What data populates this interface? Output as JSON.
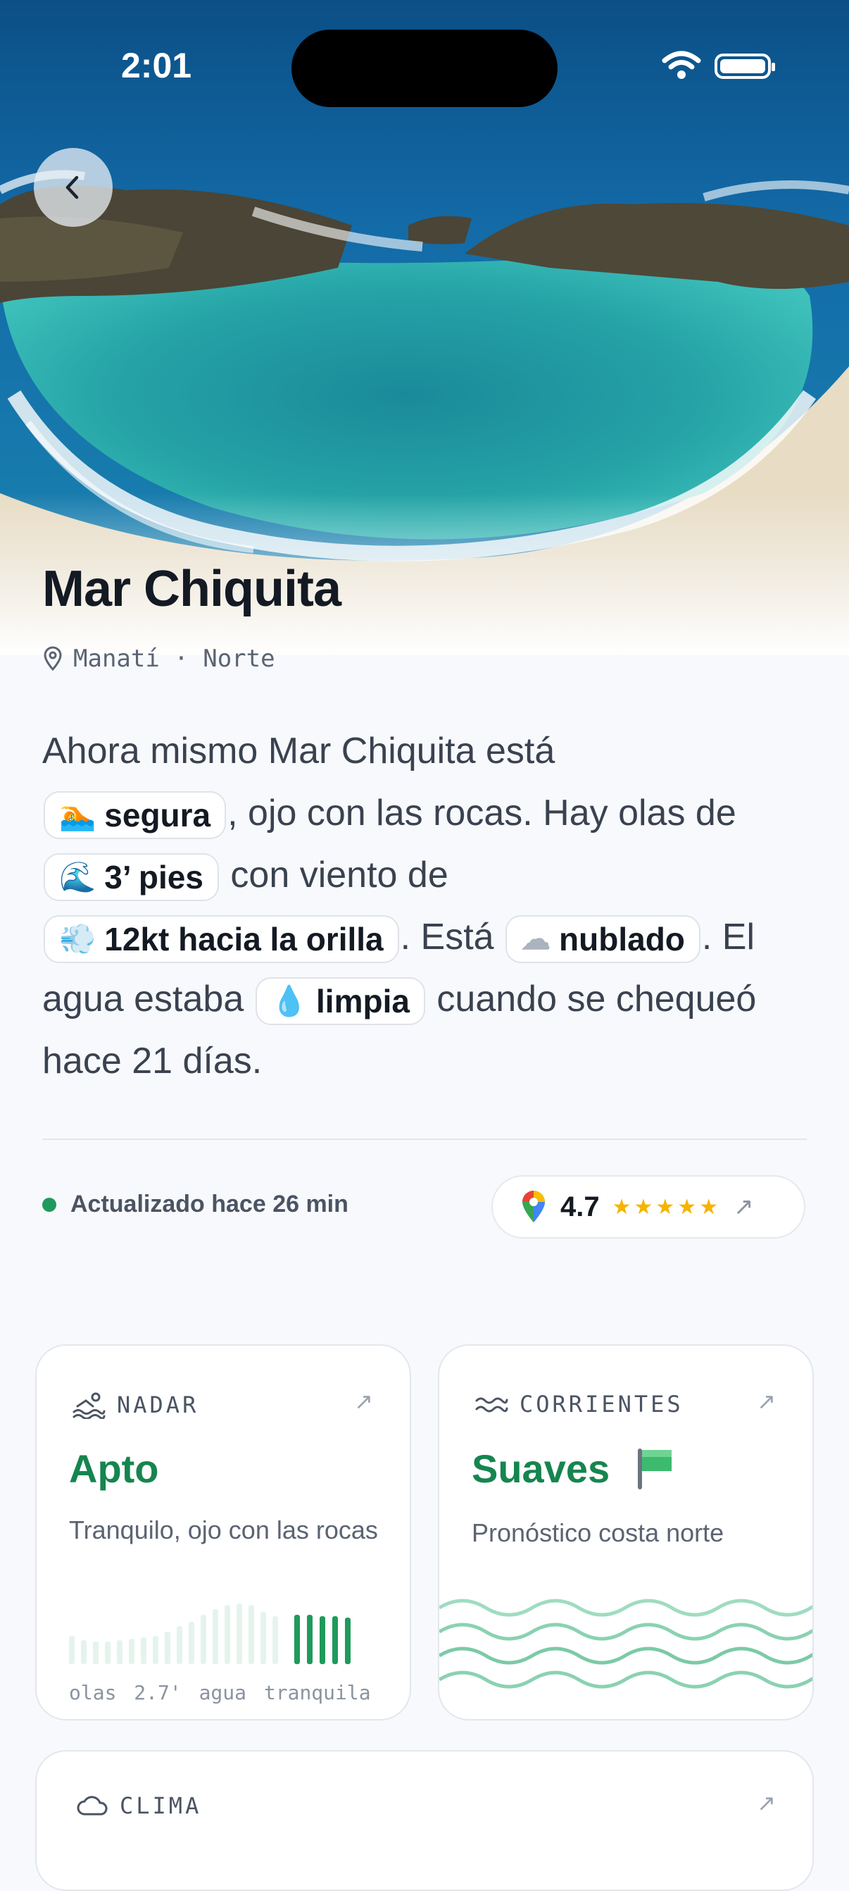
{
  "status_bar": {
    "time": "2:01",
    "icons": [
      "wifi-icon",
      "battery-icon"
    ]
  },
  "hero": {
    "back_icon": "chevron-left-icon"
  },
  "beach": {
    "name": "Mar Chiquita",
    "location": "Manatí · Norte",
    "location_icon": "map-pin-icon"
  },
  "summary": {
    "t1": "Ahora mismo Mar Chiquita está",
    "chip_safe": {
      "icon": "🏊",
      "label": "segura"
    },
    "t2": ", ojo con las rocas. Hay olas de",
    "chip_waves": {
      "icon": "🌊",
      "label": "3’ pies"
    },
    "t3": "con viento de",
    "chip_wind": {
      "icon": "💨",
      "label": "12kt hacia la orilla"
    },
    "t4": ". Está",
    "chip_sky": {
      "icon": "☁",
      "label": "nublado"
    },
    "t5": ". El agua estaba",
    "chip_water": {
      "icon": "💧",
      "label": "limpia"
    },
    "t6": "cuando se chequeó hace 21 días."
  },
  "update": {
    "text": "Actualizado hace 26 min",
    "status_color": "#1f9a5c"
  },
  "rating": {
    "value": "4.7",
    "stars": "★★★★★",
    "stars_value": 4.7,
    "icon": "google-maps-pin-icon",
    "arrow": "↗"
  },
  "cards": {
    "swim": {
      "label": "NADAR",
      "icon": "swimmer-icon",
      "arrow": "↗",
      "status": "Apto",
      "desc": "Tranquilo, ojo con las rocas",
      "footer_waves": "olas 2.7'",
      "footer_water": "agua tranquila"
    },
    "currents": {
      "label": "CORRIENTES",
      "icon": "waves-icon",
      "arrow": "↗",
      "status": "Suaves",
      "flag_icon": "green-flag-icon",
      "desc": "Pronóstico costa norte"
    },
    "weather": {
      "label": "CLIMA",
      "icon": "cloud-icon",
      "arrow": "↗"
    }
  },
  "colors": {
    "accent_green": "#16854f",
    "star": "#f5b400"
  }
}
